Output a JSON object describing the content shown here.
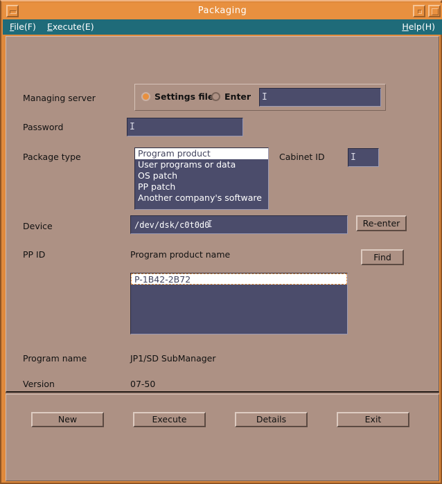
{
  "window": {
    "title": "Packaging",
    "controls": {
      "iconify": "iconify-button",
      "lower": "lower-button",
      "maximize": "maximize-button"
    }
  },
  "menubar": {
    "items": [
      {
        "mnemonic": "F",
        "before": "",
        "after": "ile(F)",
        "full": "File(F)"
      },
      {
        "mnemonic": "E",
        "before": "",
        "after": "xecute(E)",
        "full": "Execute(E)"
      },
      {
        "mnemonic": "H",
        "before": "",
        "after": "elp(H)",
        "full": "Help(H)"
      }
    ]
  },
  "form": {
    "managing_server": {
      "label": "Managing server",
      "radio_settings_file": "Settings file",
      "radio_enter": "Enter",
      "selected": "Settings file",
      "input_value": "",
      "input_caret": "I"
    },
    "password": {
      "label": "Password",
      "value": "",
      "caret": "I"
    },
    "package_type": {
      "label": "Package type",
      "options": [
        "Program product",
        "User programs or data",
        "OS patch",
        "PP patch",
        "Another company's software"
      ],
      "selected_index": 0
    },
    "cabinet_id": {
      "label": "Cabinet ID",
      "value": "",
      "caret": "I"
    },
    "device": {
      "label": "Device",
      "value": "/dev/dsk/c0t0d0",
      "caret": "I"
    },
    "re_enter_button": "Re-enter",
    "pp_id": {
      "label": "PP ID",
      "column_header": "Program product name",
      "find_button": "Find",
      "items": [
        "P-1B42-2B72"
      ],
      "selected_index": 0
    },
    "program_name": {
      "label": "Program name",
      "value": "JP1/SD SubManager"
    },
    "version": {
      "label": "Version",
      "value": "07-50"
    }
  },
  "actions": {
    "buttons": [
      {
        "label": "New"
      },
      {
        "label": "Execute"
      },
      {
        "label": "Details"
      },
      {
        "label": "Exit"
      }
    ]
  },
  "colors": {
    "frame": "#e08a3c",
    "titlebar": "#e8903f",
    "menubar": "#1f6b79",
    "client": "#ad9184",
    "field": "#4b4c6b",
    "accent": "#e8903f",
    "text": "#111111",
    "field_text": "#ffffff"
  }
}
